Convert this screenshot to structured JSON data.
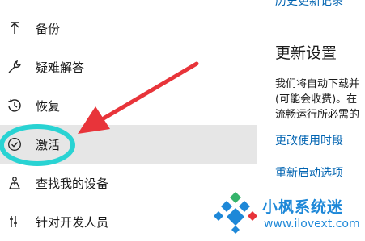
{
  "sidebar": {
    "items": [
      {
        "label": "备份",
        "icon": "arrow-up-icon"
      },
      {
        "label": "疑难解答",
        "icon": "wrench-icon"
      },
      {
        "label": "恢复",
        "icon": "history-icon"
      },
      {
        "label": "激活",
        "icon": "check-circle-icon",
        "selected": true
      },
      {
        "label": "查找我的设备",
        "icon": "person-pin-icon"
      },
      {
        "label": "针对开发人员",
        "icon": "developer-tools-icon"
      }
    ]
  },
  "main": {
    "history_link": "历史更新记录",
    "section_title": "更新设置",
    "description_lines": [
      "我们将自动下载并",
      "(可能会收费)。在",
      "流畅运行所必需的"
    ],
    "change_hours_link": "更改使用时段",
    "restart_options_link": "重新启动选项"
  },
  "watermark": {
    "title": "小枫系统迷",
    "url": "www.ilovext.com"
  },
  "colors": {
    "accent_link": "#0063b1",
    "selected_bg": "#e6e6e6",
    "annotation_arrow": "#e8343a",
    "annotation_circle": "#29d3d3",
    "watermark_blue": "#1e88d8"
  }
}
